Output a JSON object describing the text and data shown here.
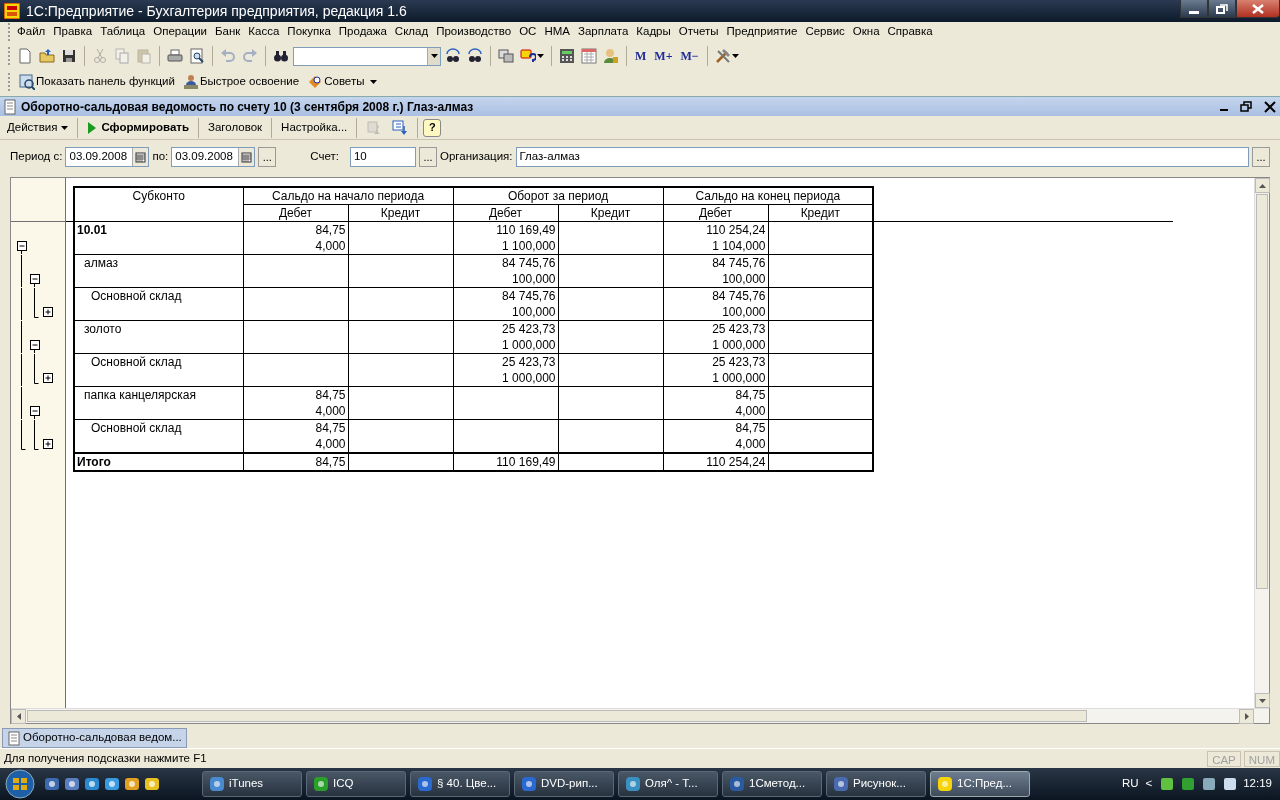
{
  "window": {
    "title": "1С:Предприятие - Бухгалтерия предприятия, редакция 1.6"
  },
  "menu": [
    "Файл",
    "Правка",
    "Таблица",
    "Операции",
    "Банк",
    "Касса",
    "Покупка",
    "Продажа",
    "Склад",
    "Производство",
    "ОС",
    "НМА",
    "Зарплата",
    "Кадры",
    "Отчеты",
    "Предприятие",
    "Сервис",
    "Окна",
    "Справка"
  ],
  "main_toolbar": [
    {
      "kind": "icon",
      "disabled": false
    },
    {
      "kind": "icon",
      "disabled": false
    },
    {
      "kind": "icon",
      "disabled": false
    },
    {
      "kind": "separator"
    },
    {
      "kind": "icon",
      "disabled": true
    },
    {
      "kind": "icon",
      "disabled": true
    },
    {
      "kind": "icon",
      "disabled": true
    },
    {
      "kind": "separator"
    },
    {
      "kind": "icon",
      "disabled": false
    },
    {
      "kind": "icon",
      "disabled": false
    },
    {
      "kind": "separator"
    },
    {
      "kind": "icon",
      "disabled": true
    },
    {
      "kind": "icon",
      "disabled": true
    },
    {
      "kind": "separator"
    },
    {
      "kind": "icon",
      "disabled": false
    },
    {
      "kind": "combo"
    },
    {
      "kind": "icon",
      "disabled": false
    },
    {
      "kind": "icon",
      "disabled": false
    },
    {
      "kind": "separator"
    },
    {
      "kind": "icon",
      "disabled": false
    },
    {
      "kind": "icon",
      "disabled": false
    },
    {
      "kind": "separator"
    },
    {
      "kind": "icon",
      "disabled": false
    },
    {
      "kind": "icon",
      "disabled": false
    },
    {
      "kind": "icon",
      "disabled": false
    },
    {
      "kind": "separator"
    },
    {
      "kind": "text",
      "label": "M"
    },
    {
      "kind": "text",
      "label": "M+"
    },
    {
      "kind": "text",
      "label": "M−"
    },
    {
      "kind": "separator"
    },
    {
      "kind": "icon",
      "disabled": false
    }
  ],
  "function_panel": [
    {
      "label": "Показать панель функций"
    },
    {
      "label": "Быстрое освоение"
    },
    {
      "label": "Советы"
    }
  ],
  "document": {
    "title": "Оборотно-сальдовая ведомость по счету 10 (3 сентября 2008 г.) Глаз-алмаз",
    "actions": [
      {
        "kind": "menu",
        "label": "Действия"
      },
      {
        "kind": "run",
        "label": "Сформировать"
      },
      {
        "kind": "plain",
        "label": "Заголовок"
      },
      {
        "kind": "plain",
        "label": "Настройка..."
      },
      {
        "kind": "icon",
        "disabled": true
      },
      {
        "kind": "icon",
        "disabled": false
      },
      {
        "kind": "help",
        "label": "?"
      }
    ],
    "filters": {
      "period_from_label": "Период с:",
      "period_from": "03.09.2008",
      "period_to_label": "по:",
      "period_to": "03.09.2008",
      "period_button": "...",
      "account_label": "Счет:",
      "account": "10",
      "account_button": "...",
      "organization_label": "Организация:",
      "organization": "Глаз-алмаз",
      "organization_button": "..."
    },
    "report": {
      "header": {
        "subkonto": "Субконто",
        "groups": [
          {
            "title": "Сальдо на начало периода",
            "debit": "Дебет",
            "credit": "Кредит"
          },
          {
            "title": "Оборот за период",
            "debit": "Дебет",
            "credit": "Кредит"
          },
          {
            "title": "Сальдо на конец периода",
            "debit": "Дебет",
            "credit": "Кредит"
          }
        ]
      },
      "rows": [
        {
          "label": "10.01",
          "kind": "group",
          "expanded": true,
          "start_debit": [
            "84,75",
            "4,000"
          ],
          "turnover_debit": [
            "110 169,49",
            "1 100,000"
          ],
          "end_debit": [
            "110 254,24",
            "1 104,000"
          ],
          "children": [
            {
              "label": "алмаз",
              "kind": "item",
              "expanded": true,
              "turnover_debit": [
                "84 745,76",
                "100,000"
              ],
              "end_debit": [
                "84 745,76",
                "100,000"
              ],
              "children": [
                {
                  "label": "Основной склад",
                  "kind": "item",
                  "expanded": false,
                  "turnover_debit": [
                    "84 745,76",
                    "100,000"
                  ],
                  "end_debit": [
                    "84 745,76",
                    "100,000"
                  ]
                }
              ]
            },
            {
              "label": "золото",
              "kind": "item",
              "expanded": true,
              "turnover_debit": [
                "25 423,73",
                "1 000,000"
              ],
              "end_debit": [
                "25 423,73",
                "1 000,000"
              ],
              "children": [
                {
                  "label": "Основной склад",
                  "kind": "item",
                  "expanded": false,
                  "turnover_debit": [
                    "25 423,73",
                    "1 000,000"
                  ],
                  "end_debit": [
                    "25 423,73",
                    "1 000,000"
                  ]
                }
              ]
            },
            {
              "label": "папка канцелярская",
              "kind": "item",
              "expanded": true,
              "start_debit": [
                "84,75",
                "4,000"
              ],
              "end_debit": [
                "84,75",
                "4,000"
              ],
              "children": [
                {
                  "label": "Основной склад",
                  "kind": "item",
                  "expanded": false,
                  "start_debit": [
                    "84,75",
                    "4,000"
                  ],
                  "end_debit": [
                    "84,75",
                    "4,000"
                  ]
                }
              ]
            }
          ]
        }
      ],
      "total": {
        "label": "Итого",
        "start_debit": [
          "84,75"
        ],
        "turnover_debit": [
          "110 169,49"
        ],
        "end_debit": [
          "110 254,24"
        ]
      }
    }
  },
  "window_tabs": [
    {
      "label": "Оборотно-сальдовая ведом...",
      "selected": true
    }
  ],
  "status_bar": {
    "hint": "Для получения подсказки нажмите F1",
    "indicators": [
      {
        "label": "CAP",
        "on": false
      },
      {
        "label": "NUM",
        "on": false
      }
    ]
  },
  "taskbar": {
    "tasks": [
      {
        "label": "iTunes",
        "selected": false
      },
      {
        "label": "ICQ",
        "selected": false
      },
      {
        "label": "§ 40. Цве...",
        "selected": false
      },
      {
        "label": "DVD-рип...",
        "selected": false
      },
      {
        "label": "Оля^ - Т...",
        "selected": false
      },
      {
        "label": "1Сметод...",
        "selected": false
      },
      {
        "label": "Рисунок...",
        "selected": false
      },
      {
        "label": "1С:Пред...",
        "selected": true
      }
    ],
    "language": "RU",
    "tray_expand": "<",
    "clock": "12:19"
  }
}
